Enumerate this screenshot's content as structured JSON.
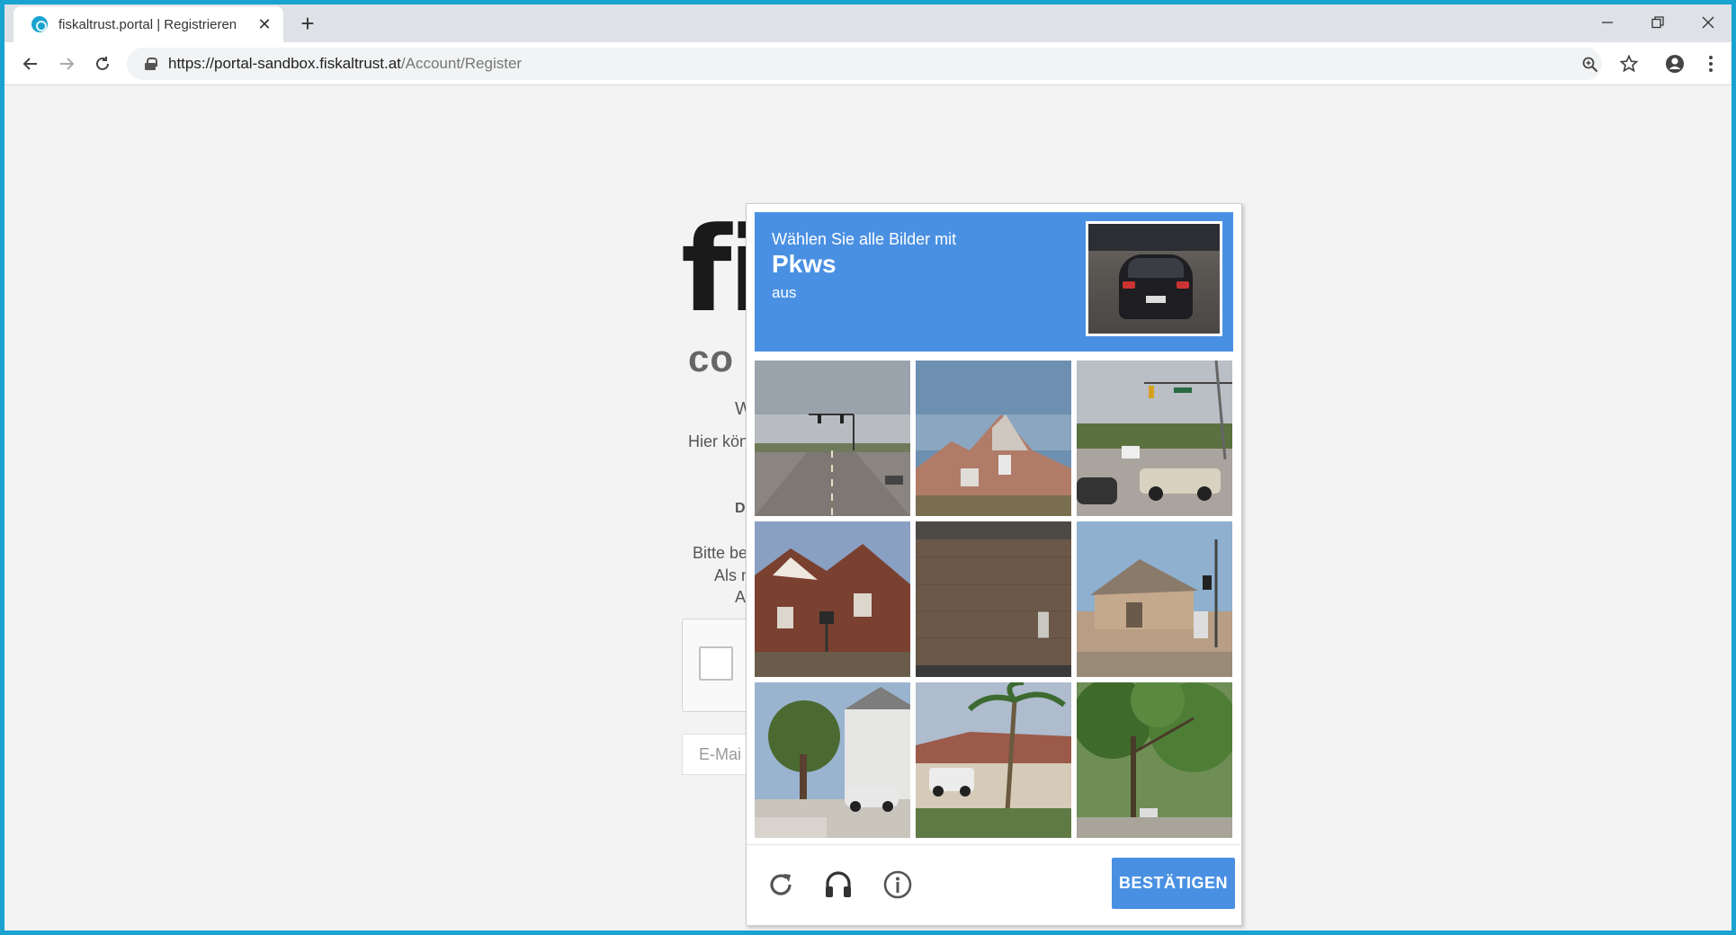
{
  "browser": {
    "tab_title": "fiskaltrust.portal | Registrieren",
    "url_host": "https://portal-sandbox.fiskaltrust.at",
    "url_path": "/Account/Register"
  },
  "page": {
    "logo_partial": "fi",
    "logo_sub_partial": "co",
    "text_w": "W",
    "text_hier": "Hier kön",
    "text_d": "D",
    "text_bitte": "Bitte be",
    "text_als": "Als n",
    "text_ac": "Ac",
    "email_placeholder": "E-Mai"
  },
  "captcha": {
    "instruction_line1": "Wählen Sie alle Bilder mit",
    "target_object": "Pkws",
    "instruction_line3": "aus",
    "verify_label": "BESTÄTIGEN",
    "tiles": [
      {
        "index": 1,
        "scene": "road-traffic-light"
      },
      {
        "index": 2,
        "scene": "house-roof"
      },
      {
        "index": 3,
        "scene": "intersection-cars"
      },
      {
        "index": 4,
        "scene": "brick-house"
      },
      {
        "index": 5,
        "scene": "brick-wall"
      },
      {
        "index": 6,
        "scene": "house-construction"
      },
      {
        "index": 7,
        "scene": "street-parked-car"
      },
      {
        "index": 8,
        "scene": "house-truck-palm"
      },
      {
        "index": 9,
        "scene": "trees-street"
      }
    ]
  },
  "colors": {
    "accent": "#4a90e2",
    "frame": "#1aa3d0"
  }
}
